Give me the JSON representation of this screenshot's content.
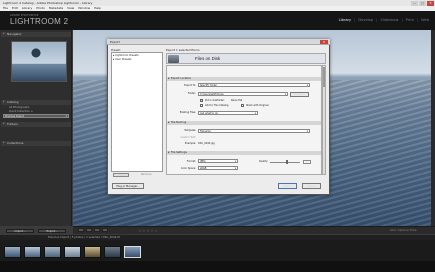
{
  "window": {
    "title": "Lightroom 2 Catalog - Adobe Photoshop Lightroom - Library",
    "minimize": "—",
    "maximize": "□",
    "close": "✕"
  },
  "menu": [
    "File",
    "Edit",
    "Library",
    "Photo",
    "Metadata",
    "View",
    "Window",
    "Help"
  ],
  "identity": {
    "small": "ADOBE PHOTOSHOP",
    "big": "LIGHTROOM 2"
  },
  "modules": [
    "Library",
    "Develop",
    "Slideshow",
    "Print",
    "Web"
  ],
  "module_sep": "|",
  "left_panel": {
    "navigator": "Navigator",
    "catalog": {
      "header": "Catalog",
      "rows": [
        {
          "label": "All Photographs",
          "count": ""
        },
        {
          "label": "Quick Collection +",
          "count": ""
        },
        {
          "label": "Previous Import",
          "count": ""
        }
      ]
    },
    "folders": {
      "header": "Folders",
      "rows": [
        {
          "label": "",
          "count": ""
        },
        {
          "label": "",
          "count": ""
        }
      ]
    },
    "collections": {
      "header": "Collections",
      "rows": [
        {
          "label": "",
          "count": ""
        },
        {
          "label": "",
          "count": ""
        }
      ]
    },
    "import_button": "Import...",
    "export_button": "Export..."
  },
  "toolbar": {
    "stars": "☆☆☆☆☆",
    "sort": "Sort: Capture Time"
  },
  "filmstrip": {
    "header": "Previous Import | 5 photos / 1 selected / DSC_0044.tif"
  },
  "dialog": {
    "title": "Export",
    "close": "✕",
    "preset_label": "Preset:",
    "presets": [
      "▸ Lightroom Presets",
      "▸ User Presets"
    ],
    "add": "Add",
    "remove": "Remove",
    "plugin_manager": "Plug-in Manager...",
    "export_to_label": "Export 1 selected file to:",
    "export_to": "Files on Disk",
    "sections": {
      "location": {
        "title": "Export Location",
        "export_to_lbl": "Export To:",
        "export_to_val": "Specific folder",
        "folder_lbl": "Folder:",
        "folder_val": "C:\\Users\\jw\\Pictures",
        "choose": "Choose...",
        "subfolder_lbl": "Put in Subfolder:",
        "subfolder_val": "Rains Fall",
        "add_catalog": "Add to This Catalog",
        "stack": "Stack with Original",
        "existing_lbl": "Existing Files:",
        "existing_val": "Ask what to do"
      },
      "naming": {
        "title": "File Naming",
        "template_lbl": "Template:",
        "template_val": "Filename",
        "custom_lbl": "Custom Text:",
        "example_lbl": "Example:",
        "example_val": "DSC_0044.jpg"
      },
      "settings": {
        "title": "File Settings",
        "format_lbl": "Format:",
        "format_val": "JPEG",
        "quality_lbl": "Quality:",
        "quality_val": "80",
        "colorspace_lbl": "Color Space:",
        "colorspace_val": "sRGB"
      }
    },
    "export_btn": "Export",
    "cancel_btn": "Cancel"
  }
}
